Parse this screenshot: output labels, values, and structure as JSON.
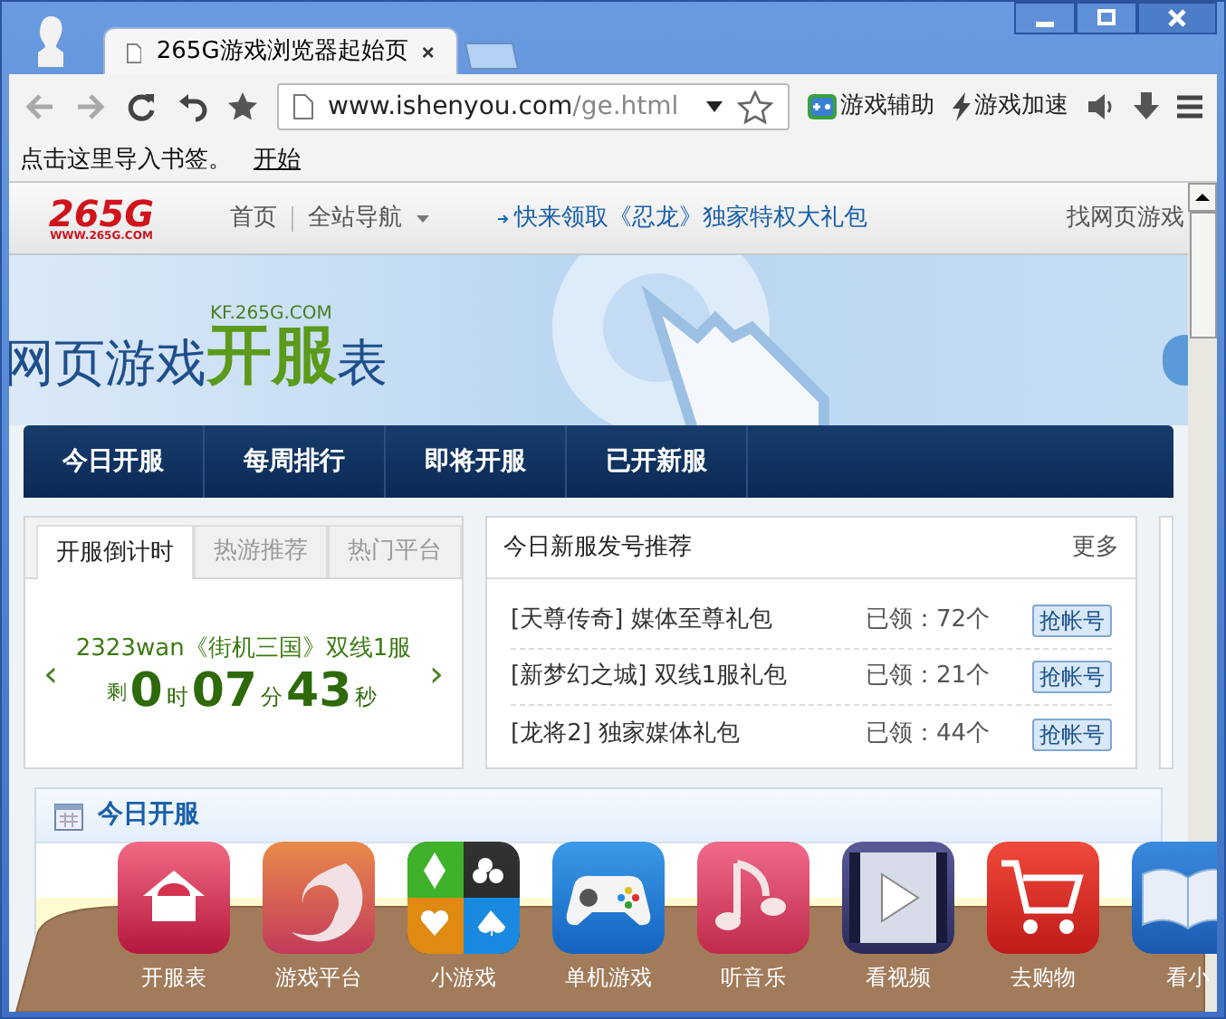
{
  "window": {
    "tab_title": "265G游戏浏览器起始页",
    "url_host": "www.ishenyou.com",
    "url_path": "/ge.html",
    "toolbar_buttons": [
      {
        "label": "游戏辅助",
        "kind": "gamepad"
      },
      {
        "label": "游戏加速",
        "kind": "bolt"
      }
    ],
    "bookmarks_hint": "点击这里导入书签。",
    "bookmarks_link": "开始"
  },
  "site_header": {
    "logo": "265G",
    "logo_sub": "WWW.265G.COM",
    "nav": [
      "首页",
      "全站导航"
    ],
    "promo": "快来领取《忍龙》独家特权大礼包",
    "right": "找网页游戏"
  },
  "banner": {
    "domain": "KF.265G.COM",
    "title_a": "网页游戏",
    "title_b": "开服",
    "title_c": "表"
  },
  "menu": [
    "今日开服",
    "每周排行",
    "即将开服",
    "已开新服"
  ],
  "countdown": {
    "tabs": [
      {
        "label": "开服倒计时",
        "selected": true
      },
      {
        "label": "热游推荐",
        "selected": false
      },
      {
        "label": "热门平台",
        "selected": false
      }
    ],
    "game": "2323wan《街机三国》双线1服",
    "prefix": "剩",
    "parts": [
      {
        "value": "0",
        "unit": "时"
      },
      {
        "value": "07",
        "unit": "分"
      },
      {
        "value": "43",
        "unit": "秒"
      }
    ],
    "prev": "‹",
    "next": "›"
  },
  "gifts": {
    "title": "今日新服发号推荐",
    "more": "更多",
    "rows": [
      {
        "name": "[天尊传奇] 媒体至尊礼包",
        "claimed": "已领：72个",
        "button": "抢帐号"
      },
      {
        "name": "[新梦幻之城] 双线1服礼包",
        "claimed": "已领：21个",
        "button": "抢帐号"
      },
      {
        "name": "[龙将2] 独家媒体礼包",
        "claimed": "已领：44个",
        "button": "抢帐号"
      }
    ]
  },
  "today": {
    "title": "今日开服"
  },
  "dock": [
    {
      "label": "开服表",
      "kind": "house"
    },
    {
      "label": "游戏平台",
      "kind": "swirl"
    },
    {
      "label": "小游戏",
      "kind": "cards"
    },
    {
      "label": "单机游戏",
      "kind": "controller"
    },
    {
      "label": "听音乐",
      "kind": "music"
    },
    {
      "label": "看视频",
      "kind": "video"
    },
    {
      "label": "去购物",
      "kind": "cart"
    },
    {
      "label": "看小",
      "kind": "book"
    }
  ]
}
